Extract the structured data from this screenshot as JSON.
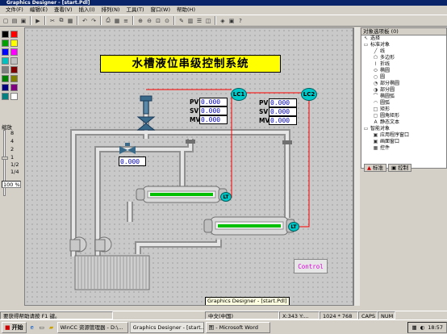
{
  "window": {
    "title": "Graphics Designer - [start.Pdl]"
  },
  "menu": [
    {
      "label": "文件(F)"
    },
    {
      "label": "编辑(E)"
    },
    {
      "label": "查看(V)"
    },
    {
      "label": "插入(I)"
    },
    {
      "label": "排列(N)"
    },
    {
      "label": "工具(T)"
    },
    {
      "label": "窗口(W)"
    },
    {
      "label": "帮助(H)"
    }
  ],
  "palette": {
    "colors": [
      "#000000",
      "#ff0000",
      "#00a000",
      "#ffff00",
      "#0000ff",
      "#ff00ff",
      "#00c0c0",
      "#c0c0c0",
      "#808080",
      "#800000",
      "#008000",
      "#808000",
      "#000080",
      "#800080",
      "#008080",
      "#ffffff"
    ],
    "zoom_label": "缩放",
    "zoom_ticks": [
      "8",
      "4",
      "2",
      "1",
      "1/2",
      "1/4"
    ],
    "zoom_value": "100 %"
  },
  "canvas": {
    "title": "水槽液位串级控制系统",
    "controllers": [
      {
        "label": "LC1",
        "pv_label": "PV",
        "sv_label": "SV",
        "mv_label": "MV",
        "pv": "0.000",
        "sv": "0.000",
        "mv": "0.000"
      },
      {
        "label": "LC2",
        "pv_label": "PV",
        "sv_label": "SV",
        "mv_label": "MV",
        "pv": "0.000",
        "sv": "0.000",
        "mv": "0.000"
      }
    ],
    "valve_value": "0.000",
    "lt1_label": "LT",
    "lt2_label": "LT",
    "control_button": "Control",
    "colors": {
      "pipe": "#d8d8d8",
      "signal": "#ff0000",
      "water": "#00c000",
      "valve": "#3a6a8a",
      "lc": "#00c8c8",
      "title_bg": "#ffff00"
    }
  },
  "tree": {
    "header": "对象选项板 (0)",
    "items": [
      {
        "label": "选择",
        "icon": "arrow"
      },
      {
        "label": "标准对象",
        "icon": "folder"
      },
      {
        "label": "线",
        "icon": "line"
      },
      {
        "label": "多边形",
        "icon": "poly"
      },
      {
        "label": "折线",
        "icon": "polyline"
      },
      {
        "label": "椭圆",
        "icon": "ellipse"
      },
      {
        "label": "圆",
        "icon": "circle"
      },
      {
        "label": "部分椭圆",
        "icon": "part-ellipse"
      },
      {
        "label": "部分圆",
        "icon": "part-circle"
      },
      {
        "label": "椭圆弧",
        "icon": "ellipse-arc"
      },
      {
        "label": "圆弧",
        "icon": "arc"
      },
      {
        "label": "矩形",
        "icon": "rect"
      },
      {
        "label": "圆角矩形",
        "icon": "round-rect"
      },
      {
        "label": "静态文本",
        "icon": "text"
      },
      {
        "label": "智能对象",
        "icon": "folder"
      },
      {
        "label": "应用程序窗口",
        "icon": "window"
      },
      {
        "label": "画面窗口",
        "icon": "window"
      },
      {
        "label": "控件",
        "icon": "control"
      }
    ],
    "tabs": [
      {
        "label": "标准"
      },
      {
        "label": "控制"
      }
    ]
  },
  "statusbar": {
    "help": "要获得帮助请按 F1 键。",
    "lang": "中文(中国)",
    "tooltip": "Graphics Designer - [start.Pdl]",
    "coords": "X:343 Y:...",
    "size": "1024 * 768",
    "caps": "CAPS",
    "num": "NUM"
  },
  "taskbar": {
    "start": "开始",
    "tasks": [
      {
        "label": "WinCC 资源管理器 - D:\\..."
      },
      {
        "label": "Graphics Designer - [start..."
      },
      {
        "label": "图 - Microsoft Word"
      }
    ],
    "clock": "18:57"
  }
}
